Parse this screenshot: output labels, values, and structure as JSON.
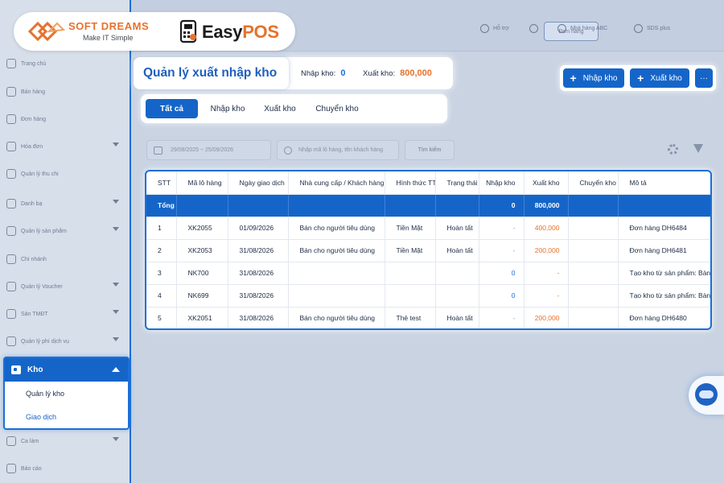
{
  "brand": {
    "softdreams_name": "SOFT DREAMS",
    "softdreams_tagline": "Make IT Simple",
    "easypos_easy": "Easy",
    "easypos_pos": "POS"
  },
  "topbar": {
    "order_button": "Đơn hàng",
    "help": "Hỗ trợ",
    "store": "Nhà hàng ABC",
    "user": "SDS plus"
  },
  "sidebar": {
    "items": [
      {
        "label": "Trang chủ"
      },
      {
        "label": "Bán hàng"
      },
      {
        "label": "Đơn hàng"
      },
      {
        "label": "Hóa đơn"
      },
      {
        "label": "Quản lý thu chi"
      },
      {
        "label": "Danh bạ"
      },
      {
        "label": "Quản lý sản phẩm"
      },
      {
        "label": "Chi nhánh"
      },
      {
        "label": "Quản lý Voucher"
      },
      {
        "label": "Sàn TMĐT"
      },
      {
        "label": "Quản lý phí dịch vụ"
      },
      {
        "label": "Ca làm"
      },
      {
        "label": "Báo cáo"
      }
    ],
    "kho": {
      "label": "Kho",
      "sub": [
        "Quản lý kho",
        "Giao dịch"
      ]
    }
  },
  "header": {
    "title": "Quản lý xuất nhập kho",
    "import_label": "Nhập kho:",
    "import_value": "0",
    "export_label": "Xuất kho:",
    "export_value": "800,000"
  },
  "actions": {
    "import_button": "Nhập kho",
    "export_button": "Xuất kho",
    "more_button": "···"
  },
  "tabs": [
    {
      "label": "Tất cả"
    },
    {
      "label": "Nhập kho"
    },
    {
      "label": "Xuất kho"
    },
    {
      "label": "Chuyển kho"
    }
  ],
  "filter": {
    "date_range": "29/08/2025  ~  25/09/2026",
    "search_placeholder": "Nhập mã lô hàng, tên khách hàng",
    "search_button": "Tìm kiếm"
  },
  "table": {
    "headers": [
      "STT",
      "Mã lô hàng",
      "Ngày giao dịch",
      "Nhà cung cấp / Khách hàng",
      "Hình thức TT",
      "Trạng thái",
      "Nhập kho",
      "Xuất kho",
      "Chuyển kho",
      "Mô tả"
    ],
    "total": {
      "label": "Tổng",
      "import": "0",
      "export": "800,000"
    },
    "rows": [
      {
        "stt": "1",
        "code": "XK2055",
        "date": "01/09/2026",
        "partner": "Bán cho người tiêu dùng",
        "payment": "Tiền Mặt",
        "status": "Hoàn tất",
        "import": "-",
        "export": "400,000",
        "transfer": "",
        "desc": "Đơn hàng DH6484"
      },
      {
        "stt": "2",
        "code": "XK2053",
        "date": "31/08/2026",
        "partner": "Bán cho người tiêu dùng",
        "payment": "Tiền Mặt",
        "status": "Hoàn tất",
        "import": "-",
        "export": "200,000",
        "transfer": "",
        "desc": "Đơn hàng DH6481"
      },
      {
        "stt": "3",
        "code": "NK700",
        "date": "31/08/2026",
        "partner": "",
        "payment": "",
        "status": "",
        "import": "0",
        "export": "-",
        "transfer": "",
        "desc": "Tạo kho từ sản phẩm: Bàn chải"
      },
      {
        "stt": "4",
        "code": "NK699",
        "date": "31/08/2026",
        "partner": "",
        "payment": "",
        "status": "",
        "import": "0",
        "export": "-",
        "transfer": "",
        "desc": "Tạo kho từ sản phẩm: Bàn chải"
      },
      {
        "stt": "5",
        "code": "XK2051",
        "date": "31/08/2026",
        "partner": "Bán cho người tiêu dùng",
        "payment": "Thẻ test",
        "status": "Hoàn tất",
        "import": "-",
        "export": "200,000",
        "transfer": "",
        "desc": "Đơn hàng DH6480"
      }
    ]
  },
  "colors": {
    "primary": "#1565c9",
    "accent_orange": "#e8712b",
    "overlay": "#c9d3e2"
  }
}
